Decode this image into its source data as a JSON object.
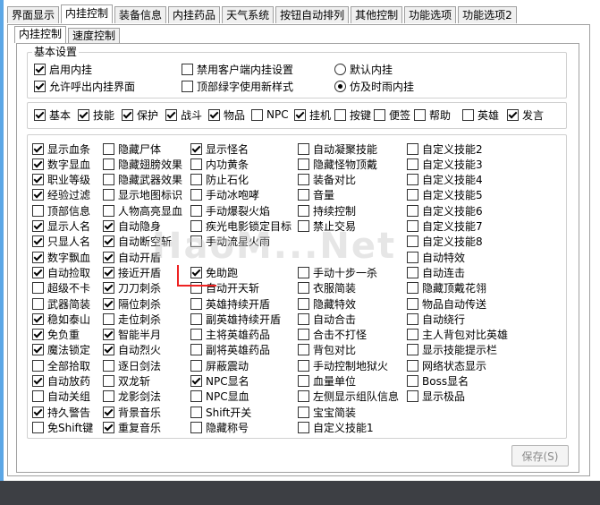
{
  "tabs": [
    "界面显示",
    "内挂控制",
    "装备信息",
    "内挂药品",
    "天气系统",
    "按钮自动排列",
    "其他控制",
    "功能选项",
    "功能选项2"
  ],
  "subtabs": [
    "内挂控制",
    "速度控制"
  ],
  "basic_settings": {
    "title": "基本设置",
    "items": [
      {
        "label": "启用内挂",
        "checked": true
      },
      {
        "label": "允许呼出内挂界面",
        "checked": true
      },
      {
        "label": "禁用客户端内挂设置",
        "checked": false
      },
      {
        "label": "顶部绿字使用新样式",
        "checked": false
      }
    ],
    "radios": [
      {
        "label": "默认内挂",
        "selected": false
      },
      {
        "label": "仿及时雨内挂",
        "selected": true
      }
    ]
  },
  "filter_row": [
    {
      "label": "基本",
      "checked": true
    },
    {
      "label": "技能",
      "checked": true
    },
    {
      "label": "保护",
      "checked": true
    },
    {
      "label": "战斗",
      "checked": true
    },
    {
      "label": "物品",
      "checked": true
    },
    {
      "label": "NPC",
      "checked": false
    },
    {
      "label": "挂机",
      "checked": true
    },
    {
      "label": "按键",
      "checked": false
    },
    {
      "label": "便签",
      "checked": false
    },
    {
      "label": "帮助",
      "checked": false
    },
    {
      "label": "英雄",
      "checked": false
    },
    {
      "label": "发言",
      "checked": true
    }
  ],
  "options_grid": [
    [
      {
        "label": "显示血条",
        "checked": true
      },
      {
        "label": "数字显血",
        "checked": true
      },
      {
        "label": "职业等级",
        "checked": true
      },
      {
        "label": "经验过滤",
        "checked": true
      },
      {
        "label": "顶部信息",
        "checked": false
      },
      {
        "label": "显示人名",
        "checked": true
      },
      {
        "label": "只显人名",
        "checked": true
      },
      {
        "label": "数字飘血",
        "checked": true
      },
      {
        "label": "自动捡取",
        "checked": true
      },
      {
        "label": "超级不卡",
        "checked": false
      },
      {
        "label": "武器简装",
        "checked": false
      },
      {
        "label": "稳如泰山",
        "checked": true
      },
      {
        "label": "免负重",
        "checked": true
      },
      {
        "label": "魔法锁定",
        "checked": true
      },
      {
        "label": "全部拾取",
        "checked": false
      },
      {
        "label": "自动放药",
        "checked": true
      },
      {
        "label": "自动关组",
        "checked": false
      },
      {
        "label": "持久警告",
        "checked": true
      },
      {
        "label": "免Shift键",
        "checked": false
      }
    ],
    [
      {
        "label": "隐藏尸体",
        "checked": false
      },
      {
        "label": "隐藏翅膀效果",
        "checked": false
      },
      {
        "label": "隐藏武器效果",
        "checked": false
      },
      {
        "label": "显示地图标识",
        "checked": false
      },
      {
        "label": "人物高亮显血",
        "checked": false
      },
      {
        "label": "自动隐身",
        "checked": true
      },
      {
        "label": "自动断空斩",
        "checked": true
      },
      {
        "label": "自动开盾",
        "checked": true
      },
      {
        "label": "接近开盾",
        "checked": true
      },
      {
        "label": "刀刀刺杀",
        "checked": true
      },
      {
        "label": "隔位刺杀",
        "checked": true
      },
      {
        "label": "走位刺杀",
        "checked": false
      },
      {
        "label": "智能半月",
        "checked": true
      },
      {
        "label": "自动烈火",
        "checked": true
      },
      {
        "label": "逐日剑法",
        "checked": false
      },
      {
        "label": "双龙斩",
        "checked": false
      },
      {
        "label": "龙影剑法",
        "checked": false
      },
      {
        "label": "背景音乐",
        "checked": true
      },
      {
        "label": "重复音乐",
        "checked": true
      }
    ],
    [
      {
        "label": "显示怪名",
        "checked": true
      },
      {
        "label": "内功黄条",
        "checked": false
      },
      {
        "label": "防止石化",
        "checked": false
      },
      {
        "label": "手动冰咆哮",
        "checked": false
      },
      {
        "label": "手动爆裂火焰",
        "checked": false
      },
      {
        "label": "疾光电影锁定目标",
        "checked": false
      },
      {
        "label": "手动流星火雨",
        "checked": false
      },
      {
        "label": "",
        "checked": false
      },
      {
        "label": "免助跑",
        "checked": true
      },
      {
        "label": "自动开天斩",
        "checked": false
      },
      {
        "label": "英雄持续开盾",
        "checked": false
      },
      {
        "label": "副英雄持续开盾",
        "checked": false
      },
      {
        "label": "主将英雄药品",
        "checked": false
      },
      {
        "label": "副将英雄药品",
        "checked": false
      },
      {
        "label": "屏蔽震动",
        "checked": false
      },
      {
        "label": "NPC显名",
        "checked": true
      },
      {
        "label": "NPC显血",
        "checked": false
      },
      {
        "label": "Shift开关",
        "checked": false
      },
      {
        "label": "隐藏称号",
        "checked": false
      }
    ],
    [
      {
        "label": "自动凝聚技能",
        "checked": false
      },
      {
        "label": "隐藏怪物顶戴",
        "checked": false
      },
      {
        "label": "装备对比",
        "checked": false
      },
      {
        "label": "音量",
        "checked": false
      },
      {
        "label": "持续控制",
        "checked": false
      },
      {
        "label": "禁止交易",
        "checked": false
      },
      {
        "label": "",
        "checked": false
      },
      {
        "label": "",
        "checked": false
      },
      {
        "label": "手动十步一杀",
        "checked": false
      },
      {
        "label": "衣服简装",
        "checked": false
      },
      {
        "label": "隐藏特效",
        "checked": false
      },
      {
        "label": "自动合击",
        "checked": false
      },
      {
        "label": "合击不打怪",
        "checked": false
      },
      {
        "label": "背包对比",
        "checked": false
      },
      {
        "label": "手动控制地狱火",
        "checked": false
      },
      {
        "label": "血量单位",
        "checked": false
      },
      {
        "label": "左侧显示组队信息",
        "checked": false
      },
      {
        "label": "宝宝简装",
        "checked": false
      },
      {
        "label": "自定义技能1",
        "checked": false
      }
    ],
    [
      {
        "label": "自定义技能2",
        "checked": false
      },
      {
        "label": "自定义技能3",
        "checked": false
      },
      {
        "label": "自定义技能4",
        "checked": false
      },
      {
        "label": "自定义技能5",
        "checked": false
      },
      {
        "label": "自定义技能6",
        "checked": false
      },
      {
        "label": "自定义技能7",
        "checked": false
      },
      {
        "label": "自定义技能8",
        "checked": false
      },
      {
        "label": "自动特效",
        "checked": false
      },
      {
        "label": "自动连击",
        "checked": false
      },
      {
        "label": "隐藏顶戴花翎",
        "checked": false
      },
      {
        "label": "物品自动传送",
        "checked": false
      },
      {
        "label": "自动绕行",
        "checked": false
      },
      {
        "label": "主人背包对比英雄",
        "checked": false
      },
      {
        "label": "显示技能提示栏",
        "checked": false
      },
      {
        "label": "网络状态显示",
        "checked": false
      },
      {
        "label": "Boss显名",
        "checked": false
      },
      {
        "label": "显示极品",
        "checked": false
      },
      {
        "label": "",
        "checked": false
      },
      {
        "label": "",
        "checked": false
      }
    ]
  ],
  "watermark": "HaoM...Net",
  "save_button": "保存(S)"
}
